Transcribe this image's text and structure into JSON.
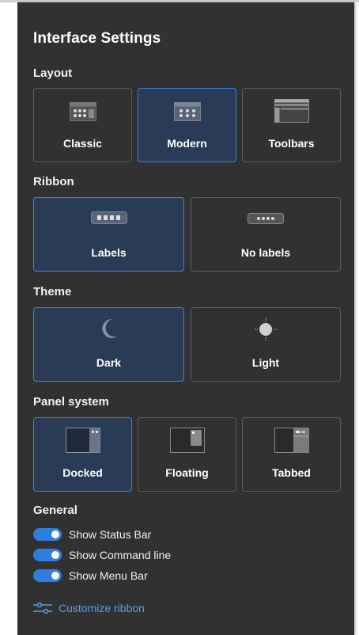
{
  "title": "Interface Settings",
  "sections": {
    "layout": {
      "label": "Layout",
      "options": [
        {
          "label": "Classic",
          "icon": "classic-layout-icon",
          "selected": false
        },
        {
          "label": "Modern",
          "icon": "modern-layout-icon",
          "selected": true
        },
        {
          "label": "Toolbars",
          "icon": "toolbars-layout-icon",
          "selected": false
        }
      ]
    },
    "ribbon": {
      "label": "Ribbon",
      "options": [
        {
          "label": "Labels",
          "icon": "ribbon-labels-icon",
          "selected": true
        },
        {
          "label": "No labels",
          "icon": "ribbon-no-labels-icon",
          "selected": false
        }
      ]
    },
    "theme": {
      "label": "Theme",
      "options": [
        {
          "label": "Dark",
          "icon": "moon-icon",
          "selected": true
        },
        {
          "label": "Light",
          "icon": "sun-icon",
          "selected": false
        }
      ]
    },
    "panel_system": {
      "label": "Panel system",
      "options": [
        {
          "label": "Docked",
          "icon": "docked-panel-icon",
          "selected": true
        },
        {
          "label": "Floating",
          "icon": "floating-panel-icon",
          "selected": false
        },
        {
          "label": "Tabbed",
          "icon": "tabbed-panel-icon",
          "selected": false
        }
      ]
    },
    "general": {
      "label": "General",
      "toggles": [
        {
          "label": "Show Status Bar",
          "on": true
        },
        {
          "label": "Show Command line",
          "on": true
        },
        {
          "label": "Show Menu Bar",
          "on": true
        }
      ]
    }
  },
  "customize_link": {
    "label": "Customize ribbon",
    "icon": "sliders-icon"
  },
  "colors": {
    "background": "#313131",
    "accent": "#2f7de1",
    "selected_fill": "#2a3b55",
    "link": "#5a9cf0"
  }
}
